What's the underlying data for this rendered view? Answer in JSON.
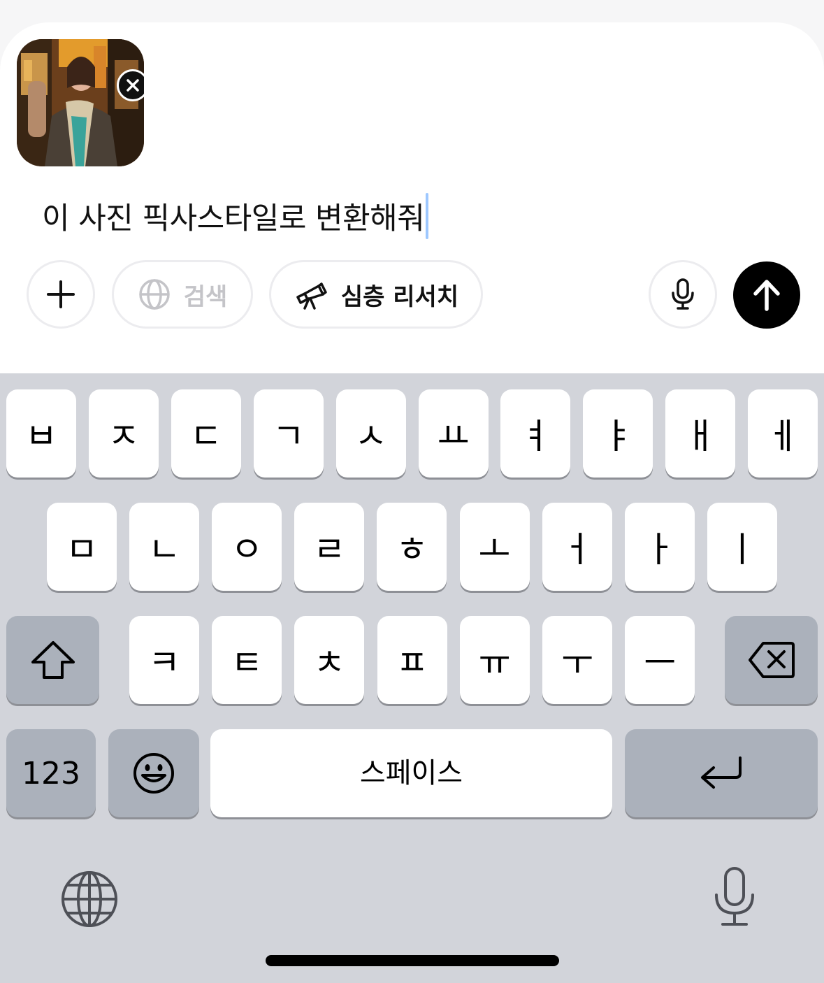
{
  "composer": {
    "attachment_alt": "photo",
    "prompt_text": "이 사진 픽사스타일로 변환해줘",
    "buttons": {
      "search_label": "검색",
      "research_label": "심층 리서치"
    },
    "icons": {
      "attach_close": "close-icon",
      "plus": "plus-icon",
      "search": "globe-icon",
      "research": "telescope-icon",
      "voice": "microphone-icon",
      "send": "arrow-up-icon"
    },
    "colors": {
      "send_bg": "#000000",
      "caret": "#9ec8ff",
      "disabled_text": "#c4c4c8"
    }
  },
  "keyboard": {
    "row1": [
      "ㅂ",
      "ㅈ",
      "ㄷ",
      "ㄱ",
      "ㅅ",
      "ㅛ",
      "ㅕ",
      "ㅑ",
      "ㅐ",
      "ㅔ"
    ],
    "row2": [
      "ㅁ",
      "ㄴ",
      "ㅇ",
      "ㄹ",
      "ㅎ",
      "ㅗ",
      "ㅓ",
      "ㅏ",
      "ㅣ"
    ],
    "row3": [
      "ㅋ",
      "ㅌ",
      "ㅊ",
      "ㅍ",
      "ㅠ",
      "ㅜ",
      "ㅡ"
    ],
    "numbers_label": "123",
    "space_label": "스페이스",
    "icons": {
      "shift": "shift-icon",
      "delete": "delete-icon",
      "emoji": "emoji-icon",
      "return": "return-icon",
      "globe": "globe-icon",
      "dictation": "microphone-icon"
    },
    "colors": {
      "background": "#d2d4da",
      "key": "#ffffff",
      "function_key": "#abb1bb"
    }
  }
}
